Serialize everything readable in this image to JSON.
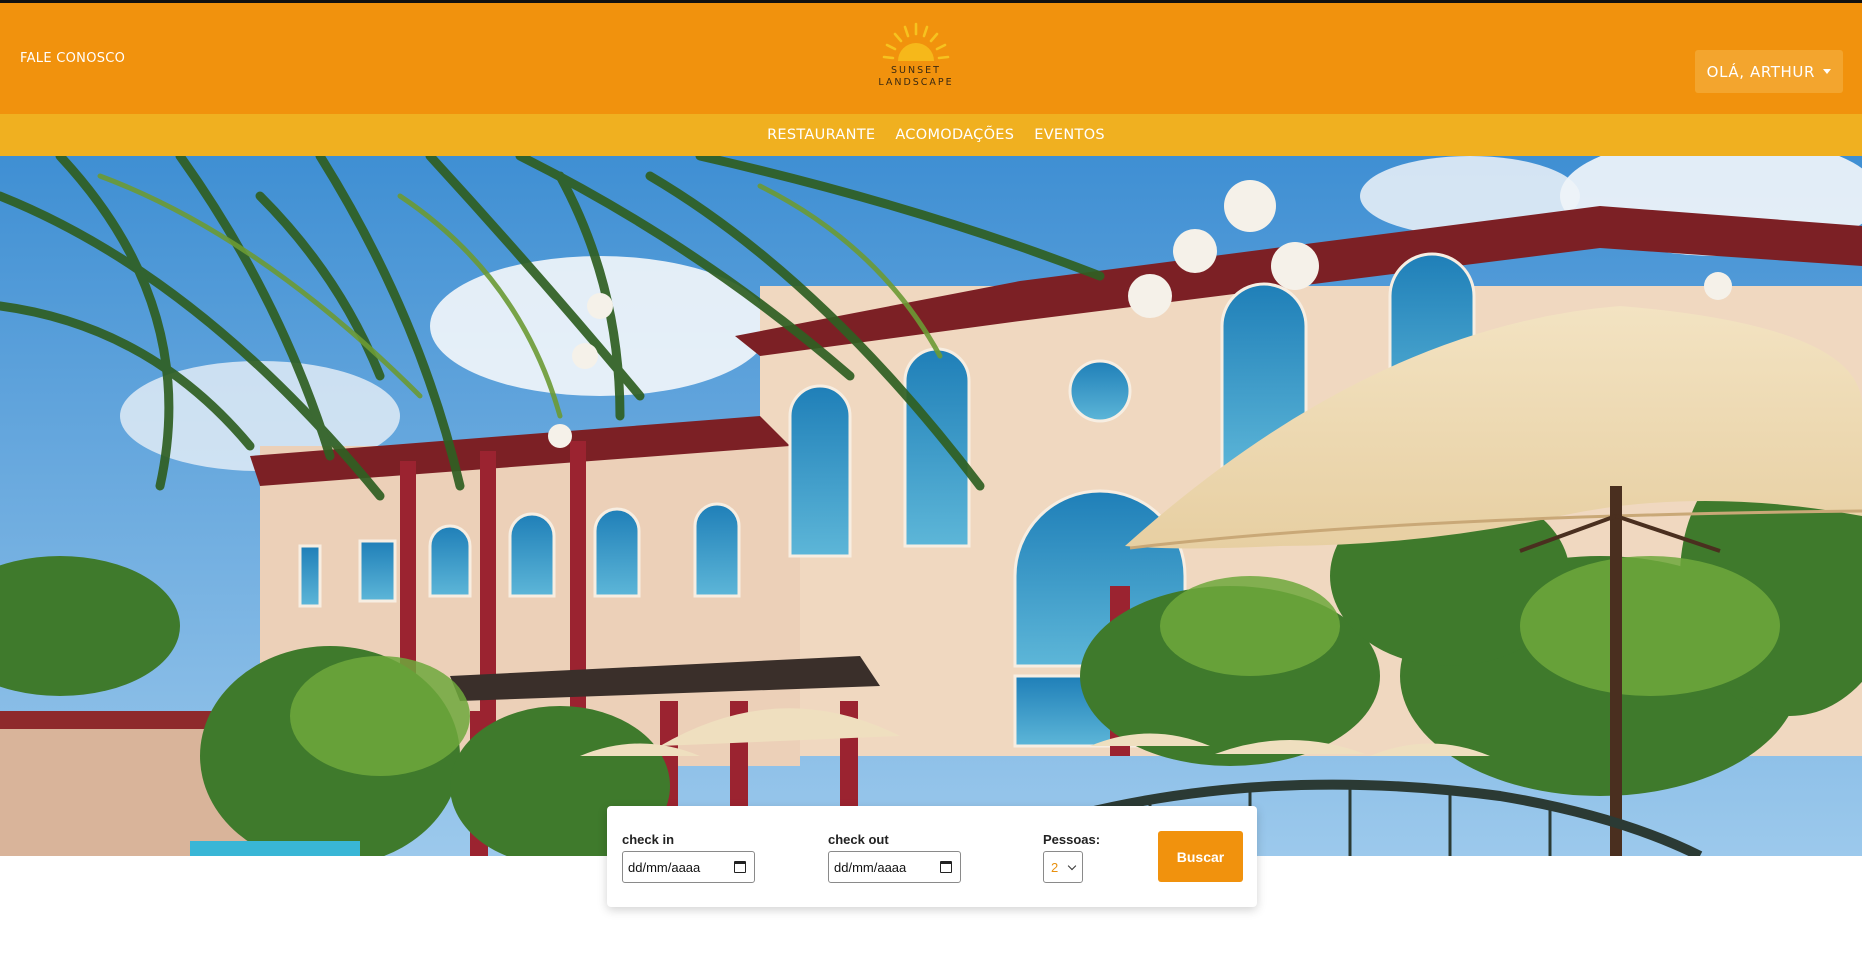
{
  "header": {
    "contact_label": "FALE CONOSCO",
    "brand_line1": "SUNSET",
    "brand_line2": "LANDSCAPE",
    "user_menu_label": "OLÁ, ARTHUR"
  },
  "nav": {
    "items": [
      {
        "label": "RESTAURANTE"
      },
      {
        "label": "ACOMODAÇÕES"
      },
      {
        "label": "EVENTOS"
      }
    ]
  },
  "booking": {
    "checkin_label": "check in",
    "checkin_placeholder": "dd/mm/aaaa",
    "checkout_label": "check out",
    "checkout_placeholder": "dd/mm/aaaa",
    "people_label": "Pessoas:",
    "people_value": "2",
    "search_label": "Buscar"
  },
  "colors": {
    "header_bg": "#f1920d",
    "nav_bg": "#f0b020",
    "accent": "#f1920d"
  },
  "icons": [
    "sun-logo-icon",
    "caret-down-icon",
    "calendar-icon",
    "chevron-down-icon"
  ]
}
